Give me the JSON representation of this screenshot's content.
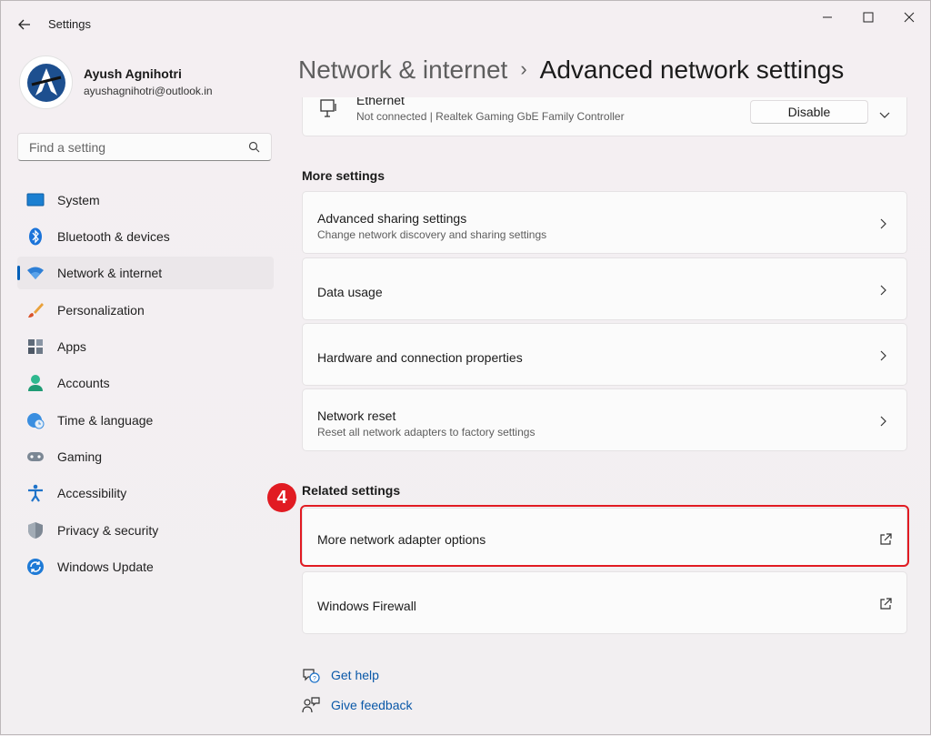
{
  "window": {
    "title": "Settings"
  },
  "user": {
    "name": "Ayush Agnihotri",
    "email": "ayushagnihotri@outlook.in"
  },
  "search": {
    "placeholder": "Find a setting"
  },
  "nav": {
    "items": [
      {
        "label": "System",
        "icon": "monitor-icon"
      },
      {
        "label": "Bluetooth & devices",
        "icon": "bluetooth-icon"
      },
      {
        "label": "Network & internet",
        "icon": "wifi-icon",
        "active": true
      },
      {
        "label": "Personalization",
        "icon": "brush-icon"
      },
      {
        "label": "Apps",
        "icon": "apps-icon"
      },
      {
        "label": "Accounts",
        "icon": "person-icon"
      },
      {
        "label": "Time & language",
        "icon": "globe-clock-icon"
      },
      {
        "label": "Gaming",
        "icon": "gamepad-icon"
      },
      {
        "label": "Accessibility",
        "icon": "accessibility-icon"
      },
      {
        "label": "Privacy & security",
        "icon": "shield-icon"
      },
      {
        "label": "Windows Update",
        "icon": "update-icon"
      }
    ]
  },
  "breadcrumb": {
    "parent": "Network & internet",
    "separator": "›",
    "current": "Advanced network settings"
  },
  "ethernet": {
    "title": "Ethernet",
    "subtitle": "Not connected | Realtek Gaming GbE Family Controller",
    "button": "Disable"
  },
  "more_settings": {
    "heading": "More settings",
    "items": [
      {
        "title": "Advanced sharing settings",
        "subtitle": "Change network discovery and sharing settings"
      },
      {
        "title": "Data usage"
      },
      {
        "title": "Hardware and connection properties"
      },
      {
        "title": "Network reset",
        "subtitle": "Reset all network adapters to factory settings"
      }
    ]
  },
  "related_settings": {
    "heading": "Related settings",
    "items": [
      {
        "title": "More network adapter options"
      },
      {
        "title": "Windows Firewall"
      }
    ]
  },
  "annotation": {
    "step": "4",
    "color": "#e11b22"
  },
  "help": {
    "get_help": "Get help",
    "give_feedback": "Give feedback"
  },
  "colors": {
    "accent": "#005fb8",
    "link": "#0a58a8"
  }
}
